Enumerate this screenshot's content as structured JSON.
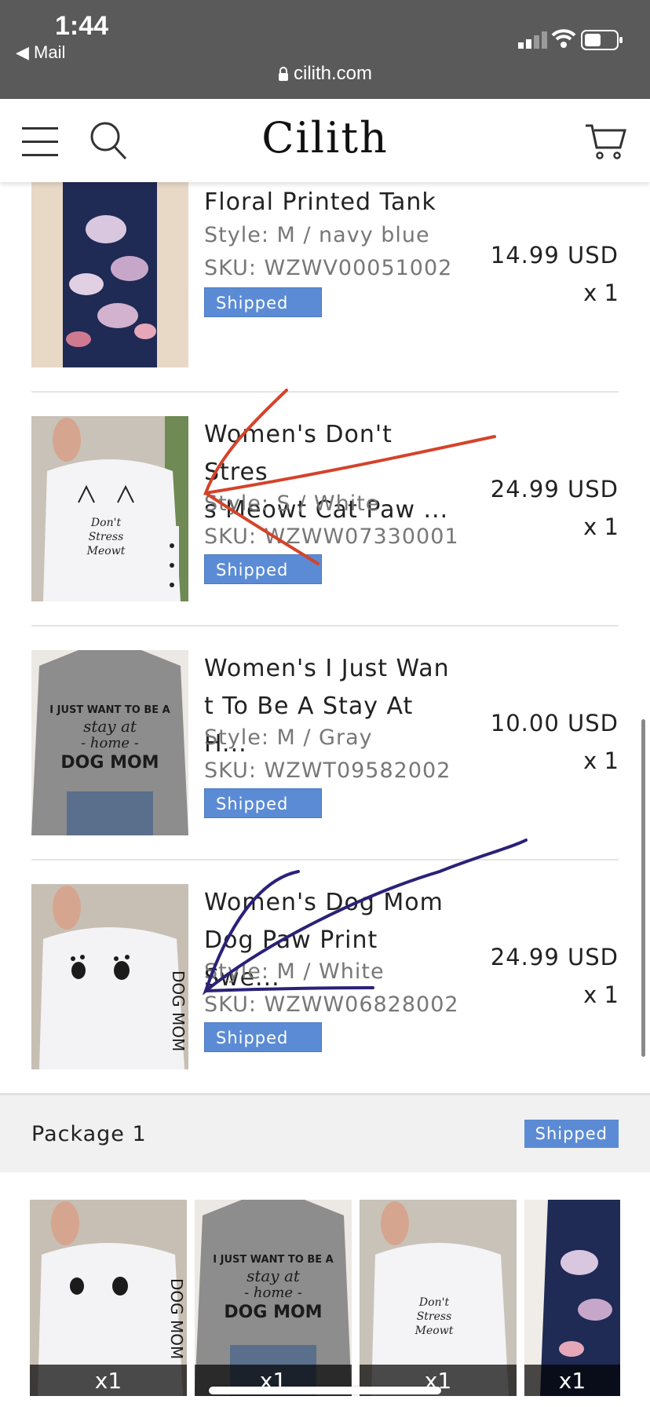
{
  "status_bar": {
    "time": "1:44",
    "back_app": "◀ Mail",
    "url": "cilith.com",
    "icons": [
      "signal-icon",
      "wifi-icon",
      "battery-icon",
      "lock-icon"
    ]
  },
  "nav": {
    "logo": "Cilith",
    "icons": [
      "menu-icon",
      "search-icon",
      "cart-icon"
    ]
  },
  "items": [
    {
      "name": "Floral Printed Tank",
      "style": "Style: M / navy blue",
      "sku": "SKU: WZWV00051002",
      "status": "Shipped",
      "price": "14.99 USD",
      "qty": "x 1"
    },
    {
      "name_line1": "Women's Don't Stres",
      "name_line2": "s Meowt Cat Paw ...",
      "style": "Style: S / White",
      "sku": "SKU: WZWW07330001",
      "status": "Shipped",
      "price": "24.99 USD",
      "qty": "x 1"
    },
    {
      "name_line1": "Women's I Just Wan",
      "name_line2": "t To Be A Stay At H...",
      "style": "Style: M / Gray",
      "sku": "SKU: WZWT09582002",
      "status": "Shipped",
      "price": "10.00 USD",
      "qty": "x 1"
    },
    {
      "name_line1": "Women's Dog Mom",
      "name_line2": "Dog Paw Print Swe...",
      "style": "Style: M / White",
      "sku": "SKU: WZWW06828002",
      "status": "Shipped",
      "price": "24.99 USD",
      "qty": "x 1"
    }
  ],
  "package": {
    "title": "Package 1",
    "status": "Shipped",
    "thumbs": [
      {
        "qty": "x1"
      },
      {
        "qty": "x1"
      },
      {
        "qty": "x1"
      },
      {
        "qty": "x1"
      }
    ]
  },
  "colors": {
    "status_badge": "#5b8bd4",
    "scribble_red": "#d4432a",
    "scribble_navy": "#2a2178"
  }
}
